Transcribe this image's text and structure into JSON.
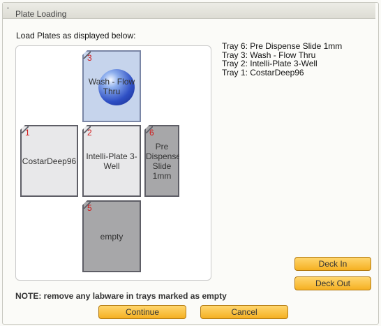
{
  "window": {
    "title": "Plate Loading"
  },
  "instructions": "Load Plates as displayed below:",
  "trays": [
    {
      "num": "3",
      "label": "Wash - Flow Thru",
      "state": "selected",
      "icon": "sphere-icon"
    },
    {
      "num": "1",
      "label": "CostarDeep96",
      "state": "light"
    },
    {
      "num": "2",
      "label": "Intelli-Plate 3-Well",
      "state": "light"
    },
    {
      "num": "6",
      "label": "Pre Dispense Slide 1mm",
      "state": "gray"
    },
    {
      "num": "5",
      "label": "empty",
      "state": "gray"
    }
  ],
  "tray_list": [
    "Tray 6: Pre Dispense Slide 1mm",
    "Tray 3: Wash - Flow Thru",
    "Tray 2: Intelli-Plate 3-Well",
    "Tray 1: CostarDeep96"
  ],
  "note": "NOTE: remove any labware in trays marked as empty",
  "buttons": {
    "deck_in": "Deck In",
    "deck_out": "Deck Out",
    "continue": "Continue",
    "cancel": "Cancel"
  },
  "colors": {
    "tray_number": "#d21818",
    "tray_selected": "#c6d4ec",
    "tray_light": "#e8e8ea",
    "tray_gray": "#a7a7a9",
    "button": "#f9c244"
  }
}
